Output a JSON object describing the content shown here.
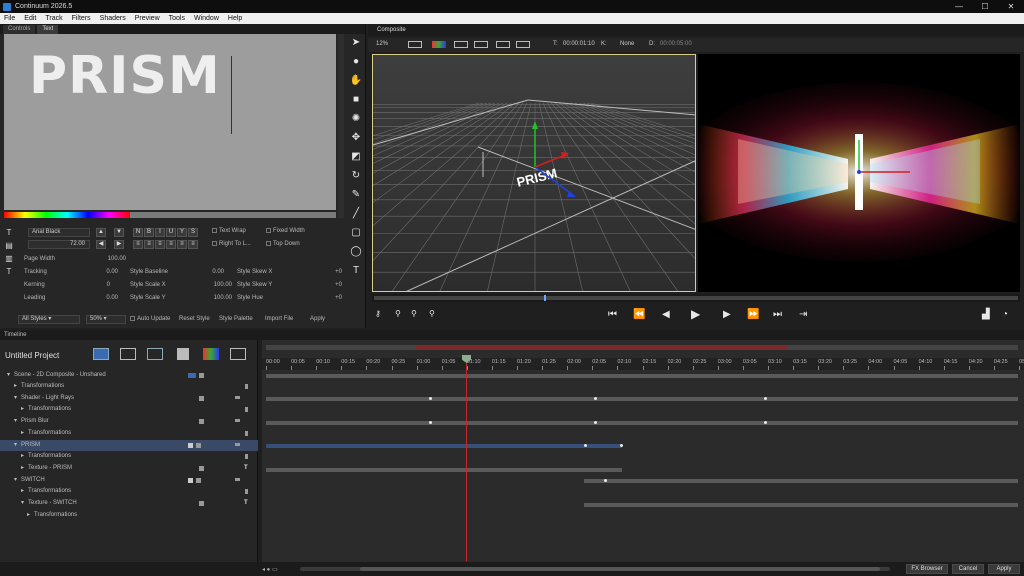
{
  "window": {
    "title": "Continuum 2026.5",
    "minimize": "—",
    "maximize": "☐",
    "close": "✕"
  },
  "menu": [
    "File",
    "Edit",
    "Track",
    "Filters",
    "Shaders",
    "Preview",
    "Tools",
    "Window",
    "Help"
  ],
  "text_panel": {
    "tabs": [
      "Controls",
      "Text"
    ],
    "canvas_text": "PRISM",
    "font": "Arial Black",
    "font_size": "72.00",
    "page_width_label": "Page Width",
    "page_width_value": "100.00",
    "options": [
      "Text Wrap",
      "Fixed Width",
      "Right To L...",
      "Top Down"
    ],
    "rows": [
      {
        "label": "Tracking",
        "value": "0.00",
        "label2": "Style Baseline",
        "value2": "0.00",
        "label3": "Style Skew X",
        "value3": "+0"
      },
      {
        "label": "Kerning",
        "value": "0",
        "label2": "Style Scale X",
        "value2": "100.00",
        "label3": "Style Skew Y",
        "value3": "+0"
      },
      {
        "label": "Leading",
        "value": "0.00",
        "label2": "Style Scale Y",
        "value2": "100.00",
        "label3": "Style Hue",
        "value3": "+0"
      }
    ],
    "bottom": {
      "styles_select": "All Styles",
      "zoom": "50%",
      "auto_update": "Auto Update",
      "reset_style": "Reset Style",
      "style_palette": "Style Palette",
      "import_file": "Import File",
      "apply": "Apply"
    },
    "style_buttons": [
      "N",
      "B",
      "I",
      "U",
      "Y",
      "S"
    ]
  },
  "composite": {
    "tab": "Composite",
    "zoom": "12%",
    "timecode_label": "T:",
    "timecode": "00:00:01:10",
    "channel": "K:",
    "mode": "None",
    "duration_label": "D:",
    "duration": "00:00:05:00",
    "viewport_text": "PRISM"
  },
  "timeline": {
    "tab": "Timeline",
    "project": "Untitled Project",
    "layers": [
      {
        "label": "Scene - 2D Composite - Unshared",
        "indent": 0
      },
      {
        "label": "Transformations",
        "indent": 1
      },
      {
        "label": "Shader - Light Rays",
        "indent": 1
      },
      {
        "label": "Transformations",
        "indent": 2
      },
      {
        "label": "Prism Blur",
        "indent": 1
      },
      {
        "label": "Transformations",
        "indent": 2
      },
      {
        "label": "PRISM",
        "indent": 1
      },
      {
        "label": "Transformations",
        "indent": 2
      },
      {
        "label": "Texture - PRISM",
        "indent": 2
      },
      {
        "label": "SWITCH",
        "indent": 1
      },
      {
        "label": "Transformations",
        "indent": 2
      },
      {
        "label": "Texture - SWITCH",
        "indent": 2
      },
      {
        "label": "Transformations",
        "indent": 3
      }
    ],
    "ruler": [
      "00:00",
      "00:05",
      "00:10",
      "00:15",
      "00:20",
      "00:25",
      "01:00",
      "01:05",
      "01:10",
      "01:15",
      "01:20",
      "01:25",
      "02:00",
      "02:05",
      "02:10",
      "02:15",
      "02:20",
      "02:25",
      "03:00",
      "03:05",
      "03:10",
      "03:15",
      "03:20",
      "03:25",
      "04:00",
      "04:05",
      "04:10",
      "04:15",
      "04:20",
      "04:25",
      "05"
    ]
  },
  "status": {
    "fx_browser": "FX Browser",
    "cancel": "Cancel",
    "apply": "Apply"
  }
}
